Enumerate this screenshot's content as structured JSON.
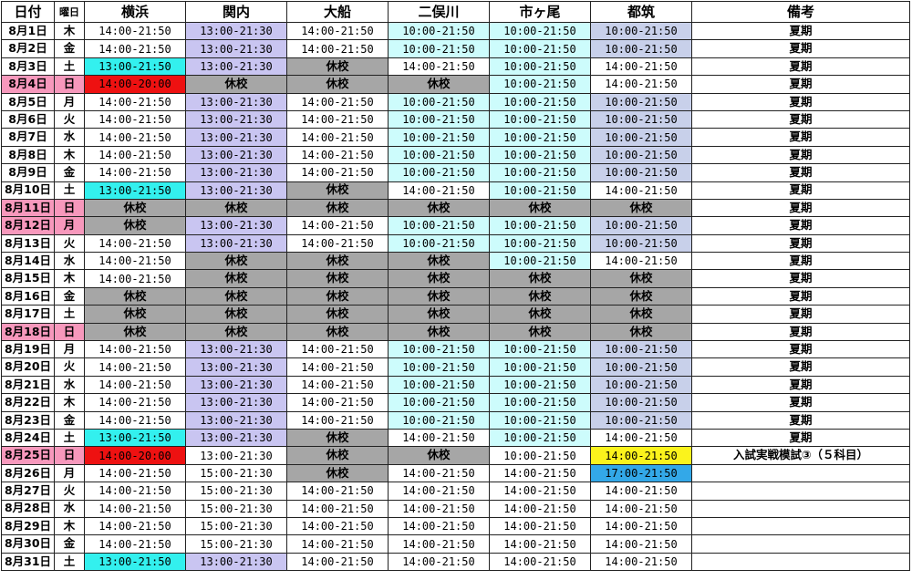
{
  "colors": {
    "white": "#ffffff",
    "cyan": "#33f0ee",
    "red": "#ee1111",
    "lav": "#c9c5f1",
    "gray": "#a6a6a6",
    "lcyan": "#cdfcfc",
    "blue": "#c8d0ea",
    "yellow": "#fbf31c",
    "sky": "#33a8e8",
    "pink": "#f798bc"
  },
  "headers": [
    "日付",
    "曜日",
    "横浜",
    "関内",
    "大船",
    "二俣川",
    "市ヶ尾",
    "都筑",
    "備考"
  ],
  "rows": [
    {
      "date": "8月1日",
      "dow": "木",
      "cells": [
        [
          "14:00-21:50",
          "white"
        ],
        [
          "13:00-21:30",
          "lav"
        ],
        [
          "14:00-21:50",
          "white"
        ],
        [
          "10:00-21:50",
          "lcyan"
        ],
        [
          "10:00-21:50",
          "lcyan"
        ],
        [
          "10:00-21:50",
          "blue"
        ]
      ],
      "note": "夏期"
    },
    {
      "date": "8月2日",
      "dow": "金",
      "cells": [
        [
          "14:00-21:50",
          "white"
        ],
        [
          "13:00-21:30",
          "lav"
        ],
        [
          "14:00-21:50",
          "white"
        ],
        [
          "10:00-21:50",
          "lcyan"
        ],
        [
          "10:00-21:50",
          "lcyan"
        ],
        [
          "10:00-21:50",
          "blue"
        ]
      ],
      "note": "夏期"
    },
    {
      "date": "8月3日",
      "dow": "土",
      "cells": [
        [
          "13:00-21:50",
          "cyan"
        ],
        [
          "13:00-21:30",
          "lav"
        ],
        [
          "休校",
          "gray"
        ],
        [
          "14:00-21:50",
          "white"
        ],
        [
          "10:00-21:50",
          "lcyan"
        ],
        [
          "14:00-21:50",
          "white"
        ]
      ],
      "note": "夏期"
    },
    {
      "date": "8月4日",
      "dow": "日",
      "hl": true,
      "cells": [
        [
          "14:00-20:00",
          "red"
        ],
        [
          "休校",
          "gray"
        ],
        [
          "休校",
          "gray"
        ],
        [
          "休校",
          "gray"
        ],
        [
          "10:00-21:50",
          "lcyan"
        ],
        [
          "14:00-21:50",
          "white"
        ]
      ],
      "note": "夏期"
    },
    {
      "date": "8月5日",
      "dow": "月",
      "cells": [
        [
          "14:00-21:50",
          "white"
        ],
        [
          "13:00-21:30",
          "lav"
        ],
        [
          "14:00-21:50",
          "white"
        ],
        [
          "10:00-21:50",
          "lcyan"
        ],
        [
          "10:00-21:50",
          "lcyan"
        ],
        [
          "10:00-21:50",
          "blue"
        ]
      ],
      "note": "夏期"
    },
    {
      "date": "8月6日",
      "dow": "火",
      "cells": [
        [
          "14:00-21:50",
          "white"
        ],
        [
          "13:00-21:30",
          "lav"
        ],
        [
          "14:00-21:50",
          "white"
        ],
        [
          "10:00-21:50",
          "lcyan"
        ],
        [
          "10:00-21:50",
          "lcyan"
        ],
        [
          "10:00-21:50",
          "blue"
        ]
      ],
      "note": "夏期"
    },
    {
      "date": "8月7日",
      "dow": "水",
      "cells": [
        [
          "14:00-21:50",
          "white"
        ],
        [
          "13:00-21:30",
          "lav"
        ],
        [
          "14:00-21:50",
          "white"
        ],
        [
          "10:00-21:50",
          "lcyan"
        ],
        [
          "10:00-21:50",
          "lcyan"
        ],
        [
          "10:00-21:50",
          "blue"
        ]
      ],
      "note": "夏期"
    },
    {
      "date": "8月8日",
      "dow": "木",
      "cells": [
        [
          "14:00-21:50",
          "white"
        ],
        [
          "13:00-21:30",
          "lav"
        ],
        [
          "14:00-21:50",
          "white"
        ],
        [
          "10:00-21:50",
          "lcyan"
        ],
        [
          "10:00-21:50",
          "lcyan"
        ],
        [
          "10:00-21:50",
          "blue"
        ]
      ],
      "note": "夏期"
    },
    {
      "date": "8月9日",
      "dow": "金",
      "cells": [
        [
          "14:00-21:50",
          "white"
        ],
        [
          "13:00-21:30",
          "lav"
        ],
        [
          "14:00-21:50",
          "white"
        ],
        [
          "10:00-21:50",
          "lcyan"
        ],
        [
          "10:00-21:50",
          "lcyan"
        ],
        [
          "10:00-21:50",
          "blue"
        ]
      ],
      "note": "夏期"
    },
    {
      "date": "8月10日",
      "dow": "土",
      "cells": [
        [
          "13:00-21:50",
          "cyan"
        ],
        [
          "13:00-21:30",
          "lav"
        ],
        [
          "休校",
          "gray"
        ],
        [
          "14:00-21:50",
          "white"
        ],
        [
          "10:00-21:50",
          "lcyan"
        ],
        [
          "14:00-21:50",
          "white"
        ]
      ],
      "note": "夏期"
    },
    {
      "date": "8月11日",
      "dow": "日",
      "hl": true,
      "cells": [
        [
          "休校",
          "gray"
        ],
        [
          "休校",
          "gray"
        ],
        [
          "休校",
          "gray"
        ],
        [
          "休校",
          "gray"
        ],
        [
          "休校",
          "gray"
        ],
        [
          "休校",
          "gray"
        ]
      ],
      "note": "夏期"
    },
    {
      "date": "8月12日",
      "dow": "月",
      "hl": true,
      "cells": [
        [
          "休校",
          "gray"
        ],
        [
          "13:00-21:30",
          "lav"
        ],
        [
          "14:00-21:50",
          "white"
        ],
        [
          "10:00-21:50",
          "lcyan"
        ],
        [
          "10:00-21:50",
          "lcyan"
        ],
        [
          "10:00-21:50",
          "blue"
        ]
      ],
      "note": "夏期"
    },
    {
      "date": "8月13日",
      "dow": "火",
      "cells": [
        [
          "14:00-21:50",
          "white"
        ],
        [
          "13:00-21:30",
          "lav"
        ],
        [
          "14:00-21:50",
          "white"
        ],
        [
          "10:00-21:50",
          "lcyan"
        ],
        [
          "10:00-21:50",
          "lcyan"
        ],
        [
          "10:00-21:50",
          "blue"
        ]
      ],
      "note": "夏期"
    },
    {
      "date": "8月14日",
      "dow": "水",
      "cells": [
        [
          "14:00-21:50",
          "white"
        ],
        [
          "休校",
          "gray"
        ],
        [
          "休校",
          "gray"
        ],
        [
          "休校",
          "gray"
        ],
        [
          "10:00-21:50",
          "lcyan"
        ],
        [
          "14:00-21:50",
          "white"
        ]
      ],
      "note": "夏期"
    },
    {
      "date": "8月15日",
      "dow": "木",
      "cells": [
        [
          "14:00-21:50",
          "white"
        ],
        [
          "休校",
          "gray"
        ],
        [
          "休校",
          "gray"
        ],
        [
          "休校",
          "gray"
        ],
        [
          "休校",
          "gray"
        ],
        [
          "休校",
          "gray"
        ]
      ],
      "note": "夏期"
    },
    {
      "date": "8月16日",
      "dow": "金",
      "cells": [
        [
          "休校",
          "gray"
        ],
        [
          "休校",
          "gray"
        ],
        [
          "休校",
          "gray"
        ],
        [
          "休校",
          "gray"
        ],
        [
          "休校",
          "gray"
        ],
        [
          "休校",
          "gray"
        ]
      ],
      "note": "夏期"
    },
    {
      "date": "8月17日",
      "dow": "土",
      "cells": [
        [
          "休校",
          "gray"
        ],
        [
          "休校",
          "gray"
        ],
        [
          "休校",
          "gray"
        ],
        [
          "休校",
          "gray"
        ],
        [
          "休校",
          "gray"
        ],
        [
          "休校",
          "gray"
        ]
      ],
      "note": "夏期"
    },
    {
      "date": "8月18日",
      "dow": "日",
      "hl": true,
      "cells": [
        [
          "休校",
          "gray"
        ],
        [
          "休校",
          "gray"
        ],
        [
          "休校",
          "gray"
        ],
        [
          "休校",
          "gray"
        ],
        [
          "休校",
          "gray"
        ],
        [
          "休校",
          "gray"
        ]
      ],
      "note": "夏期"
    },
    {
      "date": "8月19日",
      "dow": "月",
      "cells": [
        [
          "14:00-21:50",
          "white"
        ],
        [
          "13:00-21:30",
          "lav"
        ],
        [
          "14:00-21:50",
          "white"
        ],
        [
          "10:00-21:50",
          "lcyan"
        ],
        [
          "10:00-21:50",
          "lcyan"
        ],
        [
          "10:00-21:50",
          "blue"
        ]
      ],
      "note": "夏期"
    },
    {
      "date": "8月20日",
      "dow": "火",
      "cells": [
        [
          "14:00-21:50",
          "white"
        ],
        [
          "13:00-21:30",
          "lav"
        ],
        [
          "14:00-21:50",
          "white"
        ],
        [
          "10:00-21:50",
          "lcyan"
        ],
        [
          "10:00-21:50",
          "lcyan"
        ],
        [
          "10:00-21:50",
          "blue"
        ]
      ],
      "note": "夏期"
    },
    {
      "date": "8月21日",
      "dow": "水",
      "cells": [
        [
          "14:00-21:50",
          "white"
        ],
        [
          "13:00-21:30",
          "lav"
        ],
        [
          "14:00-21:50",
          "white"
        ],
        [
          "10:00-21:50",
          "lcyan"
        ],
        [
          "10:00-21:50",
          "lcyan"
        ],
        [
          "10:00-21:50",
          "blue"
        ]
      ],
      "note": "夏期"
    },
    {
      "date": "8月22日",
      "dow": "木",
      "cells": [
        [
          "14:00-21:50",
          "white"
        ],
        [
          "13:00-21:30",
          "lav"
        ],
        [
          "14:00-21:50",
          "white"
        ],
        [
          "10:00-21:50",
          "lcyan"
        ],
        [
          "10:00-21:50",
          "lcyan"
        ],
        [
          "10:00-21:50",
          "blue"
        ]
      ],
      "note": "夏期"
    },
    {
      "date": "8月23日",
      "dow": "金",
      "cells": [
        [
          "14:00-21:50",
          "white"
        ],
        [
          "13:00-21:30",
          "lav"
        ],
        [
          "14:00-21:50",
          "white"
        ],
        [
          "10:00-21:50",
          "lcyan"
        ],
        [
          "10:00-21:50",
          "lcyan"
        ],
        [
          "10:00-21:50",
          "blue"
        ]
      ],
      "note": "夏期"
    },
    {
      "date": "8月24日",
      "dow": "土",
      "cells": [
        [
          "13:00-21:50",
          "cyan"
        ],
        [
          "13:00-21:30",
          "lav"
        ],
        [
          "休校",
          "gray"
        ],
        [
          "14:00-21:50",
          "white"
        ],
        [
          "10:00-21:50",
          "lcyan"
        ],
        [
          "14:00-21:50",
          "white"
        ]
      ],
      "note": "夏期"
    },
    {
      "date": "8月25日",
      "dow": "日",
      "hl": true,
      "cells": [
        [
          "14:00-20:00",
          "red"
        ],
        [
          "13:00-21:30",
          "white"
        ],
        [
          "休校",
          "gray"
        ],
        [
          "休校",
          "gray"
        ],
        [
          "10:00-21:50",
          "white"
        ],
        [
          "14:00-21:50",
          "yellow"
        ]
      ],
      "note": "入試実戦模試③（５科目）"
    },
    {
      "date": "8月26日",
      "dow": "月",
      "cells": [
        [
          "14:00-21:50",
          "white"
        ],
        [
          "15:00-21:30",
          "white"
        ],
        [
          "休校",
          "gray"
        ],
        [
          "14:00-21:50",
          "white"
        ],
        [
          "14:00-21:50",
          "white"
        ],
        [
          "17:00-21:50",
          "sky"
        ]
      ],
      "note": ""
    },
    {
      "date": "8月27日",
      "dow": "火",
      "cells": [
        [
          "14:00-21:50",
          "white"
        ],
        [
          "15:00-21:30",
          "white"
        ],
        [
          "14:00-21:50",
          "white"
        ],
        [
          "14:00-21:50",
          "white"
        ],
        [
          "14:00-21:50",
          "white"
        ],
        [
          "14:00-21:50",
          "white"
        ]
      ],
      "note": ""
    },
    {
      "date": "8月28日",
      "dow": "水",
      "cells": [
        [
          "14:00-21:50",
          "white"
        ],
        [
          "15:00-21:30",
          "white"
        ],
        [
          "14:00-21:50",
          "white"
        ],
        [
          "14:00-21:50",
          "white"
        ],
        [
          "14:00-21:50",
          "white"
        ],
        [
          "14:00-21:50",
          "white"
        ]
      ],
      "note": ""
    },
    {
      "date": "8月29日",
      "dow": "木",
      "cells": [
        [
          "14:00-21:50",
          "white"
        ],
        [
          "15:00-21:30",
          "white"
        ],
        [
          "14:00-21:50",
          "white"
        ],
        [
          "14:00-21:50",
          "white"
        ],
        [
          "14:00-21:50",
          "white"
        ],
        [
          "14:00-21:50",
          "white"
        ]
      ],
      "note": ""
    },
    {
      "date": "8月30日",
      "dow": "金",
      "cells": [
        [
          "14:00-21:50",
          "white"
        ],
        [
          "15:00-21:30",
          "white"
        ],
        [
          "14:00-21:50",
          "white"
        ],
        [
          "14:00-21:50",
          "white"
        ],
        [
          "14:00-21:50",
          "white"
        ],
        [
          "14:00-21:50",
          "white"
        ]
      ],
      "note": ""
    },
    {
      "date": "8月31日",
      "dow": "土",
      "cells": [
        [
          "13:00-21:50",
          "cyan"
        ],
        [
          "13:00-21:30",
          "lav"
        ],
        [
          "14:00-21:50",
          "white"
        ],
        [
          "14:00-21:50",
          "white"
        ],
        [
          "14:00-21:50",
          "white"
        ],
        [
          "14:00-21:50",
          "white"
        ]
      ],
      "note": ""
    }
  ]
}
